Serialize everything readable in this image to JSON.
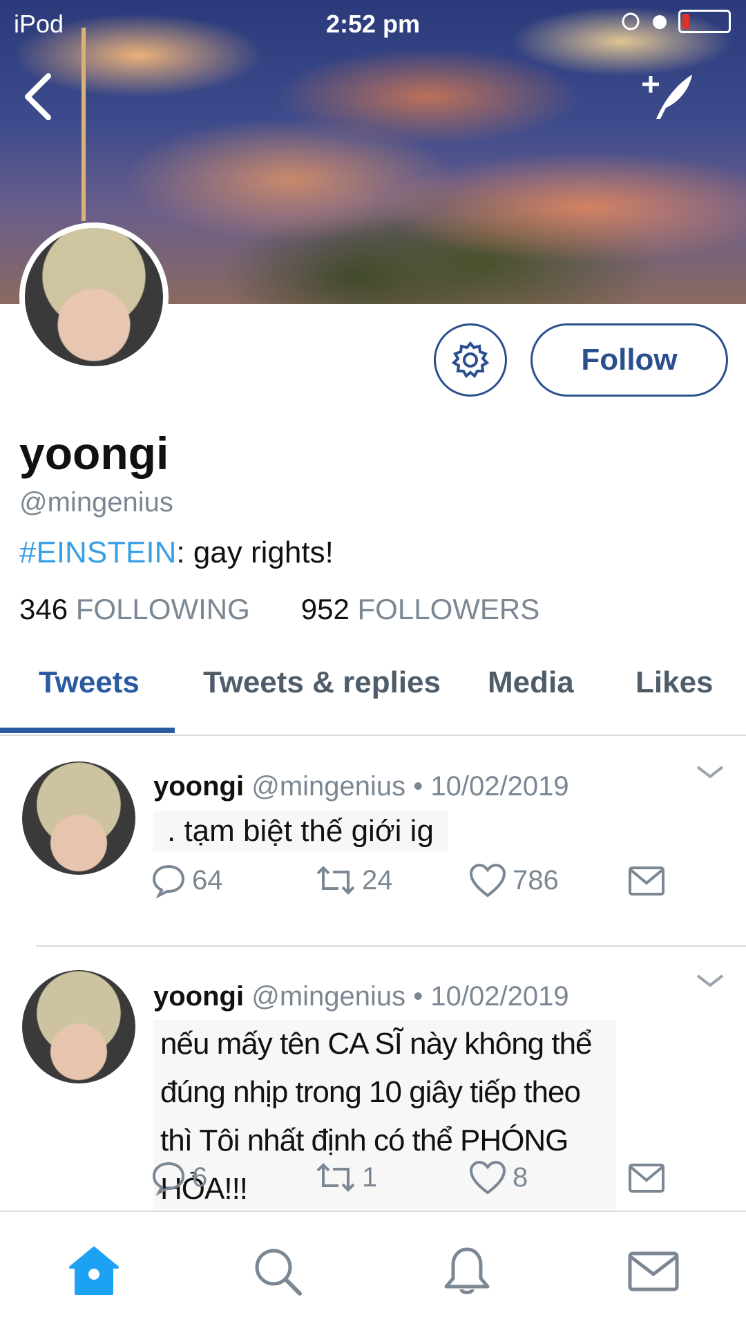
{
  "status_bar": {
    "carrier": "iPod",
    "time": "2:52 pm"
  },
  "profile": {
    "name": "yoongi",
    "handle": "@mingenius",
    "bio_tag": "#EINSTEIN",
    "bio_text": ": gay rights!",
    "following_count": "346",
    "following_label": "FOLLOWING",
    "followers_count": "952",
    "followers_label": "FOLLOWERS",
    "follow_label": "Follow"
  },
  "tabs": [
    {
      "label": "Tweets",
      "active": true
    },
    {
      "label": "Tweets & replies",
      "active": false
    },
    {
      "label": "Media",
      "active": false
    },
    {
      "label": "Likes",
      "active": false
    }
  ],
  "tweets": [
    {
      "name": "yoongi",
      "handle": "@mingenius",
      "date": "• 10/02/2019",
      "text": ". tạm biệt thế giới ig",
      "replies": "64",
      "retweets": "24",
      "likes": "786"
    },
    {
      "name": "yoongi",
      "handle": "@mingenius",
      "date": "• 10/02/2019",
      "text": "nếu mấy tên CA SĨ này không thể đúng nhịp trong 10 giây tiếp theo thì Tôi nhất định có thể PHÓNG HỎA!!!",
      "replies": "6",
      "retweets": "1",
      "likes": "8"
    }
  ],
  "colors": {
    "accent": "#2a5aa0",
    "link": "#3aa0e6",
    "muted": "#7b8793"
  },
  "icons": [
    "back-icon",
    "compose-icon",
    "gear-icon",
    "reply-icon",
    "retweet-icon",
    "like-icon",
    "message-icon",
    "home-icon",
    "search-icon",
    "notifications-icon",
    "messages-icon"
  ]
}
